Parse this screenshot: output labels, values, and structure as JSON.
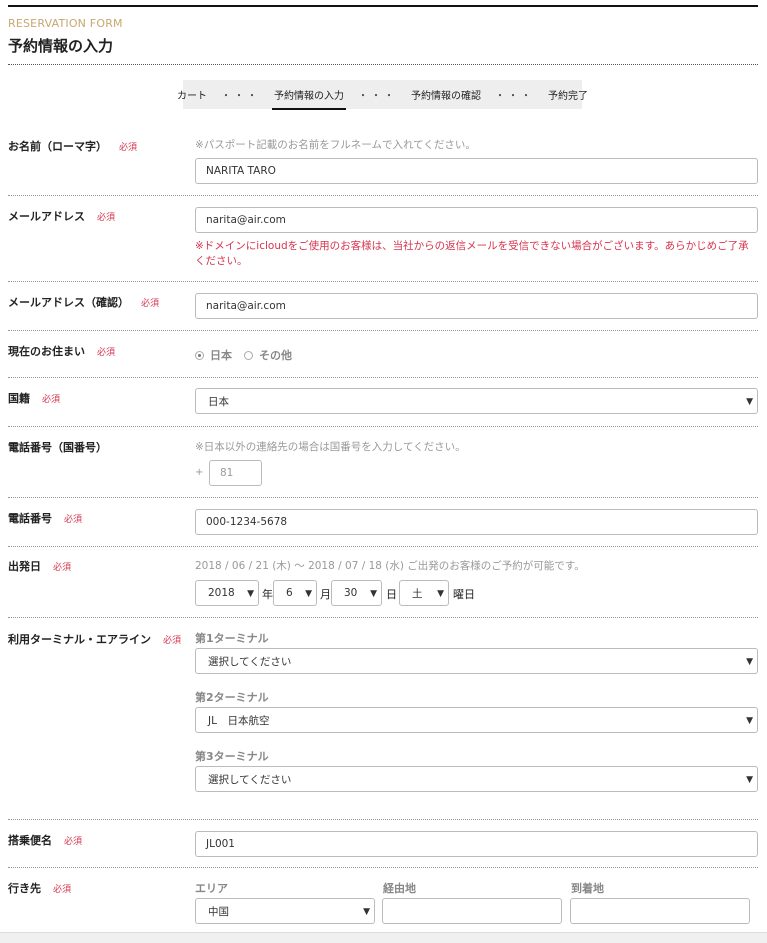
{
  "header": {
    "form_label": "RESERVATION FORM",
    "title": "予約情報の入力"
  },
  "steps": [
    {
      "label": "カート"
    },
    {
      "label": "予約情報の入力"
    },
    {
      "label": "予約情報の確認"
    },
    {
      "label": "予約完了"
    }
  ],
  "step_separator": "・・・",
  "required_tag": "必須",
  "name": {
    "label": "お名前（ローマ字）",
    "note": "※パスポート記載のお名前をフルネームで入れてください。",
    "value": "NARITA TARO"
  },
  "email": {
    "label": "メールアドレス",
    "value": "narita@air.com",
    "warning": "※ドメインにicloudをご使用のお客様は、当社からの返信メールを受信できない場合がございます。あらかじめご了承ください。"
  },
  "email_confirm": {
    "label": "メールアドレス（確認）",
    "value": "narita@air.com"
  },
  "residence": {
    "label": "現在のお住まい",
    "options": [
      "日本",
      "その他"
    ],
    "selected": "日本"
  },
  "nationality": {
    "label": "国籍",
    "value": "日本"
  },
  "country_code": {
    "label": "電話番号（国番号）",
    "note": "※日本以外の連絡先の場合は国番号を入力してください。",
    "prefix": "+",
    "placeholder": "81"
  },
  "phone": {
    "label": "電話番号",
    "value": "000-1234-5678"
  },
  "departure": {
    "label": "出発日",
    "note": "2018 / 06 / 21 (木) ～ 2018 / 07 / 18 (水) ご出発のお客様のご予約が可能です。",
    "year": "2018",
    "year_unit": "年",
    "month": "6",
    "month_unit": "月",
    "day": "30",
    "day_unit": "日",
    "weekday": "土",
    "weekday_unit": "曜日"
  },
  "terminal": {
    "label": "利用ターミナル・エアライン",
    "groups": [
      {
        "label": "第1ターミナル",
        "value": "選択してください"
      },
      {
        "label": "第2ターミナル",
        "value": "JL　日本航空"
      },
      {
        "label": "第3ターミナル",
        "value": "選択してください"
      }
    ]
  },
  "flight": {
    "label": "搭乗便名",
    "value": "JL001"
  },
  "destination": {
    "label": "行き先",
    "area_label": "エリア",
    "area_value": "中国",
    "via_label": "経由地",
    "via_value": "",
    "arrival_label": "到着地",
    "arrival_value": ""
  },
  "icons": {
    "caret": "▼"
  }
}
